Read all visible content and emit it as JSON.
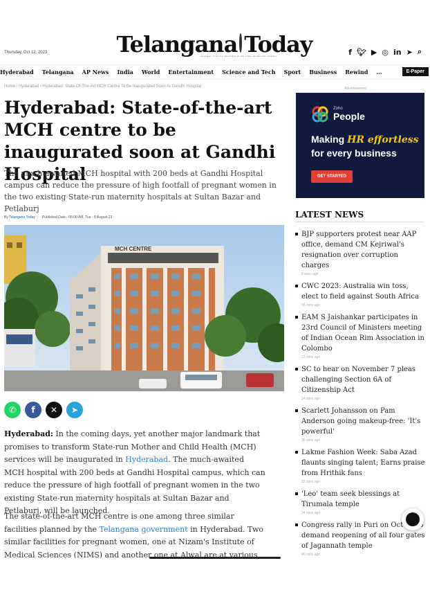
{
  "header": {
    "date": "Thursday, Oct 12, 2023",
    "logo_left": "Telangana",
    "logo_right": "Today",
    "tagline": "RELEVANT TO ROOTS. ANCHORED IN THE TIMES. ADVANCING TOWARDS",
    "social": [
      "facebook-icon",
      "twitter-icon",
      "youtube-icon",
      "instagram-icon",
      "linkedin-icon",
      "telegram-icon",
      "search-icon"
    ]
  },
  "nav": {
    "items": [
      "Hyderabad",
      "Telangana",
      "AP News",
      "India",
      "World",
      "Entertainment",
      "Science and Tech",
      "Sport",
      "Business",
      "Rewind",
      "..."
    ],
    "epaper": "E-Paper"
  },
  "breadcrumb": "Home / Hyderabad / Hyderabad: State-Of-The-Art MCH Centre To Be Inaugurated Soon At Gandhi Hospital",
  "ad_label": "Advertisement",
  "article": {
    "headline": "Hyderabad: State-of-the-art MCH centre to be inaugurated soon at Gandhi Hospital",
    "summary": "The much-awaited MCH hospital with 200 beds at Gandhi Hospital campus can reduce the pressure of high footfall of pregnant women in the two existing State-run maternity hospitals at Sultan Bazar and Petlaburj",
    "byline_prefix": "By",
    "author": "Telangana Today",
    "published": "Published Date - 08:00 AM, Tue - 8 August 23",
    "para1": {
      "dateline": "Hyderabad:",
      "text_a": " In the coming days, yet another major landmark that promises to transform State-run Mother and Child Health (MCH) services will be inaugurated in ",
      "link": "Hyderabad",
      "text_b": ". The much-awaited MCH hospital with 200 beds at Gandhi Hospital campus, which can reduce the pressure of high footfall of pregnant women in the two existing State-run maternity hospitals at Sultan Bazar and Petlaburj, will be launched."
    },
    "para2": {
      "text_a": "The state-of-the-art MCH centre is one among three similar facilities planned by the ",
      "link": "Telangana government",
      "text_b": " in Hyderabad. Two similar facilities for pregnant women, one at Nizam's Institute of Medical Sciences (NIMS) and another one at Alwal are at various stages of"
    },
    "image_sign": "MCH CENTRE",
    "share": [
      {
        "name": "whatsapp-icon",
        "glyph": "✆",
        "color": "#25d366"
      },
      {
        "name": "facebook-icon",
        "glyph": "f",
        "color": "#3b5998"
      },
      {
        "name": "x-icon",
        "glyph": "✕",
        "color": "#111111"
      },
      {
        "name": "telegram-icon",
        "glyph": "➤",
        "color": "#2aa3db"
      }
    ]
  },
  "ad": {
    "brand_small": "Zoho",
    "brand_big": "People",
    "line1_a": "Making ",
    "line1_accent": "HR effortless",
    "line2": "for every business",
    "cta": "GET STARTED"
  },
  "latest": {
    "title": "LATEST NEWS",
    "items": [
      {
        "title": "BJP supporters protest near AAP office, demand CM Kejriwal's resignation over corruption charges",
        "time": "8 mins ago"
      },
      {
        "title": "CWC 2023: Australia win toss, elect to field against South Africa",
        "time": "18 mins ago"
      },
      {
        "title": "EAM S Jaishankar participates in 23rd Council of Ministers meeting of Indian Ocean Rim Association in Colombo",
        "time": "23 mins ago"
      },
      {
        "title": "SC to hear on November 7 pleas challenging Section 6A of Citizenship Act",
        "time": "24 mins ago"
      },
      {
        "title": "Scarlett Johansson on Pam Anderson going makeup-free: 'It's powerful'",
        "time": "30 mins ago"
      },
      {
        "title": "Lakme Fashion Week: Saba Azad flaunts singing talent; Earns praise from Hrithik fans",
        "time": "32 mins ago"
      },
      {
        "title": "'Leo' team seek blessings at Tirumala temple",
        "time": "34 mins ago"
      },
      {
        "title": "Congress rally in Puri on Oct 16 to demand reopening of all four gates of Jagannath temple",
        "time": "40 mins ago"
      }
    ]
  },
  "colors": {
    "link": "#2a7fd4",
    "ad_bg": "#0f1a3d",
    "ad_accent": "#f5c518",
    "ad_button": "#e0403a"
  }
}
